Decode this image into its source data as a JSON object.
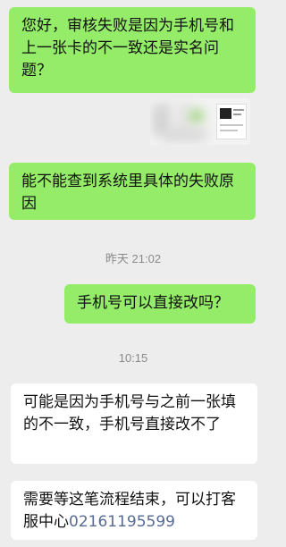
{
  "messages": [
    {
      "text": "您好，审核失败是因为手机号和上一张卡的不一致还是实名问题？"
    },
    {
      "image_icon": "screenshot-thumbnail"
    },
    {
      "text": "能不能查到系统里具体的失败原因"
    },
    {
      "timestamp": "昨天 21:02"
    },
    {
      "text": "手机号可以直接改吗？"
    },
    {
      "timestamp": "10:15"
    },
    {
      "text": "可能是因为手机号与之前一张填的不一致，手机号直接改不了"
    },
    {
      "text_prefix": "需要等这笔流程结束，可以打客服中心",
      "phone": "02161195599"
    }
  ],
  "colors": {
    "background": "#ededed",
    "outgoing_bubble": "#95ec69",
    "incoming_bubble": "#ffffff",
    "link": "#576b95",
    "timestamp": "#8a8a8a"
  }
}
